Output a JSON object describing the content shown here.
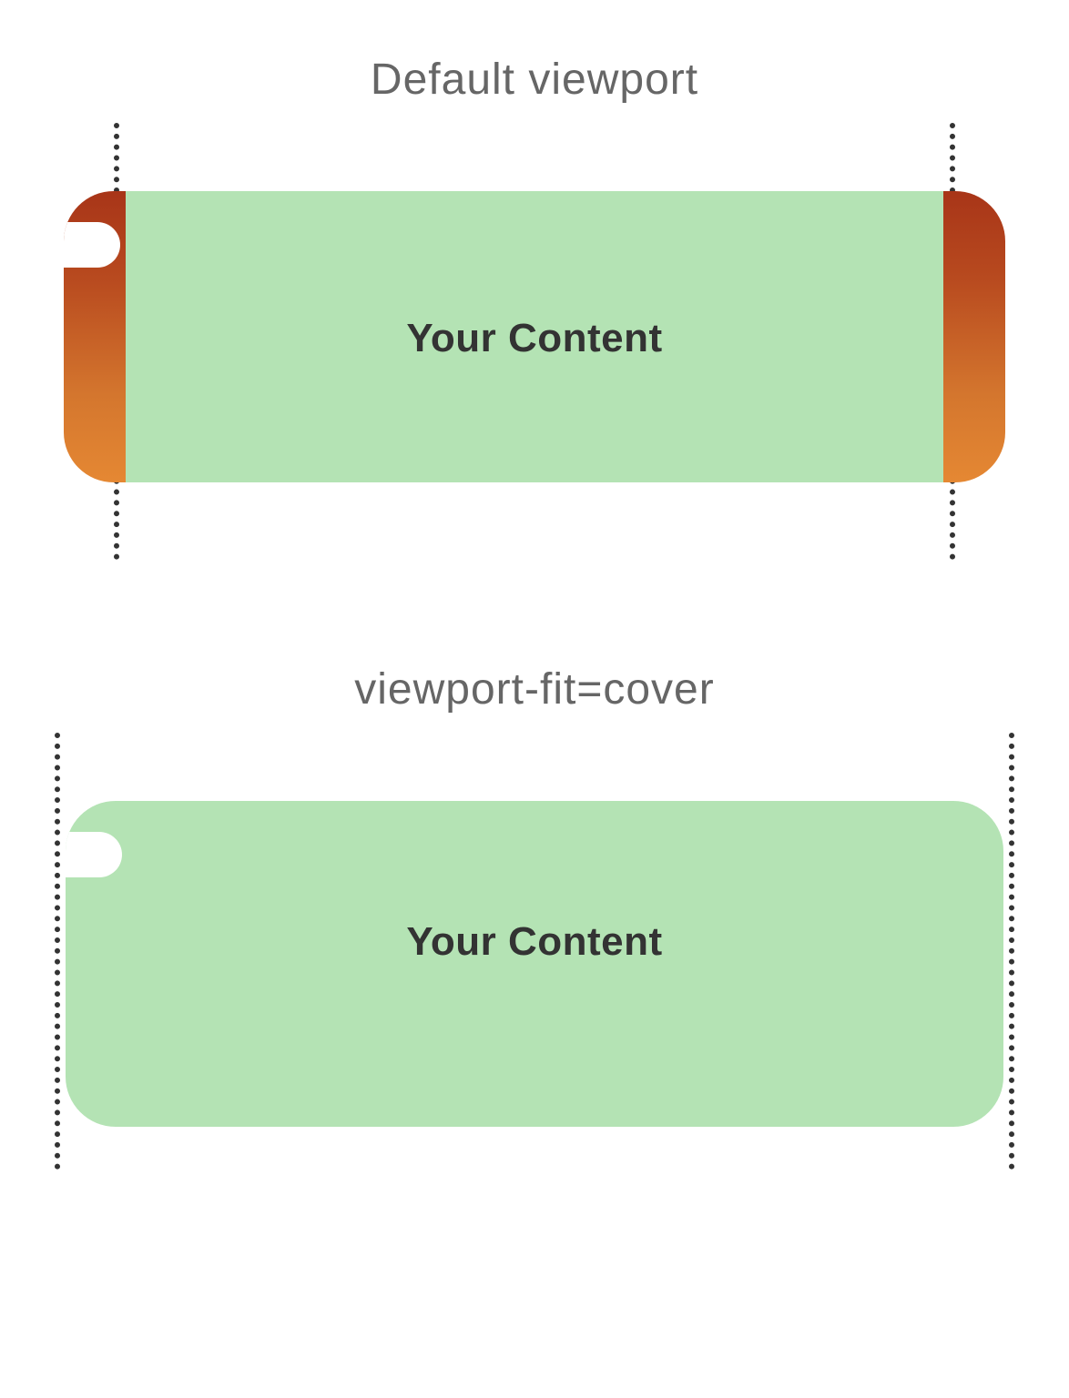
{
  "diagram1": {
    "title": "Default viewport",
    "content_label": "Your Content"
  },
  "diagram2": {
    "title": "viewport-fit=cover",
    "content_label": "Your Content"
  },
  "colors": {
    "phone_background_top": "#a83518",
    "phone_background_bottom": "#e58833",
    "content_background": "#b4e3b4",
    "text": "#333333",
    "title": "#666666"
  }
}
